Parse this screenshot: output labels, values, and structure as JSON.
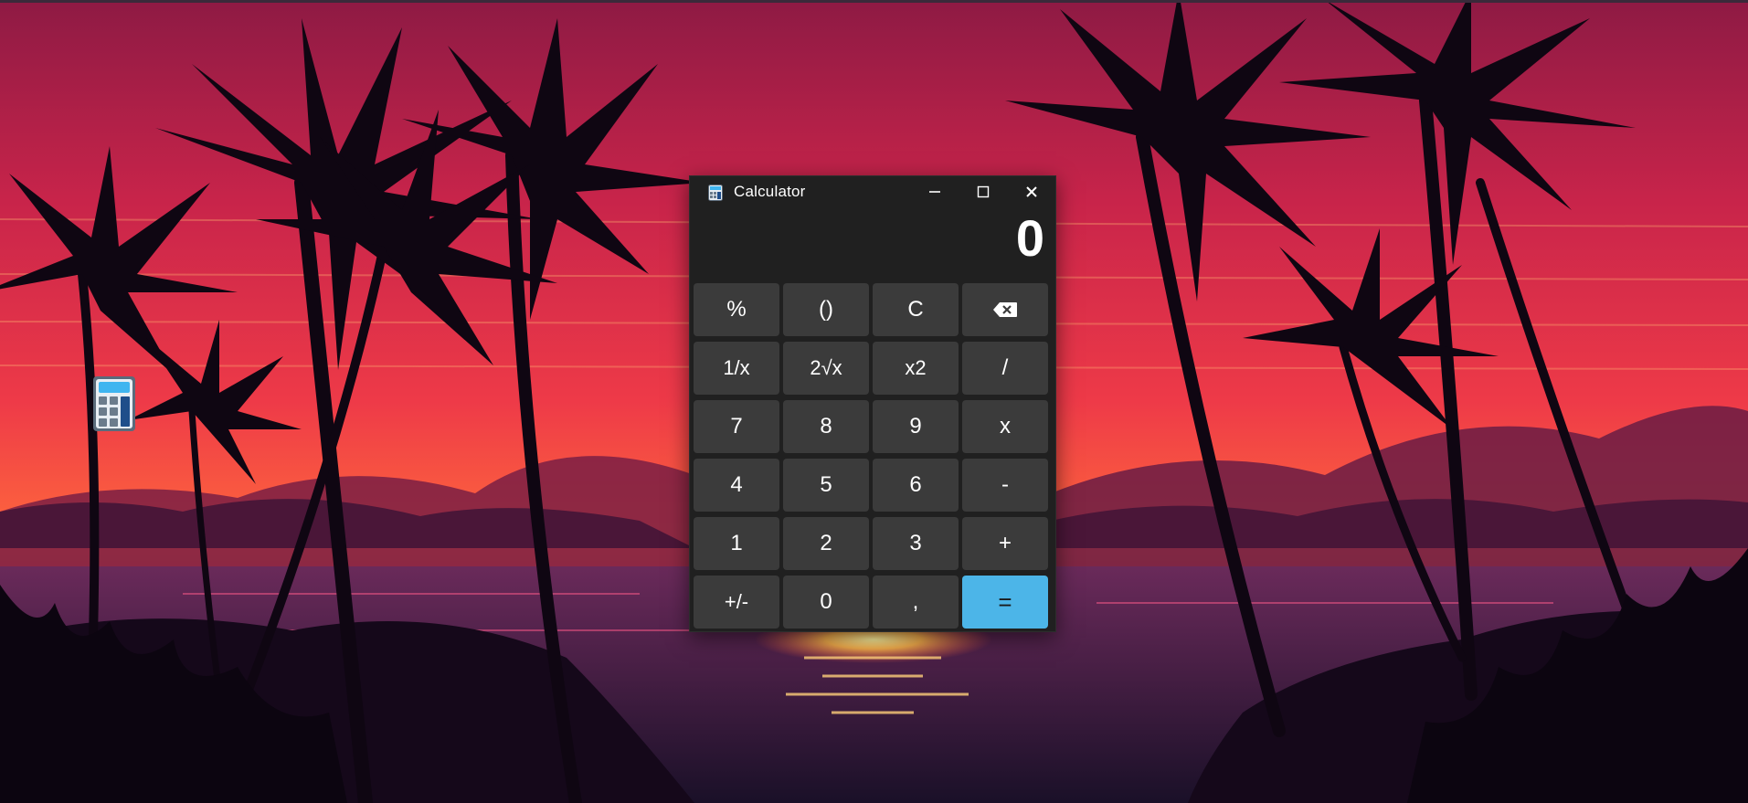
{
  "window": {
    "title": "Calculator",
    "icon": "calculator-icon",
    "controls": [
      "minimize-icon",
      "maximize-icon",
      "close-icon"
    ]
  },
  "display": {
    "value": "0"
  },
  "keys": [
    {
      "label": "%",
      "name": "percent-button"
    },
    {
      "label": "()",
      "name": "parentheses-button"
    },
    {
      "label": "C",
      "name": "clear-button"
    },
    {
      "label": "",
      "name": "backspace-button",
      "icon": "backspace-icon"
    },
    {
      "label": "1/x",
      "name": "reciprocal-button"
    },
    {
      "label": "2√x",
      "name": "square-root-button"
    },
    {
      "label": "x2",
      "name": "square-button"
    },
    {
      "label": "/",
      "name": "divide-button"
    },
    {
      "label": "7",
      "name": "digit-7-button"
    },
    {
      "label": "8",
      "name": "digit-8-button"
    },
    {
      "label": "9",
      "name": "digit-9-button"
    },
    {
      "label": "x",
      "name": "multiply-button"
    },
    {
      "label": "4",
      "name": "digit-4-button"
    },
    {
      "label": "5",
      "name": "digit-5-button"
    },
    {
      "label": "6",
      "name": "digit-6-button"
    },
    {
      "label": "-",
      "name": "subtract-button"
    },
    {
      "label": "1",
      "name": "digit-1-button"
    },
    {
      "label": "2",
      "name": "digit-2-button"
    },
    {
      "label": "3",
      "name": "digit-3-button"
    },
    {
      "label": "+",
      "name": "add-button"
    },
    {
      "label": "+/-",
      "name": "negate-button"
    },
    {
      "label": "0",
      "name": "digit-0-button"
    },
    {
      "label": ",",
      "name": "decimal-button"
    },
    {
      "label": "=",
      "name": "equals-button"
    }
  ],
  "desktop": {
    "shortcut_icon": "calculator-icon"
  },
  "colors": {
    "window_bg": "#202020",
    "key_bg": "#3b3b3b",
    "accent": "#4cb5e8",
    "sky_top": "#a81e48",
    "sky_mid": "#e8324a",
    "horizon": "#ff7a3a"
  }
}
